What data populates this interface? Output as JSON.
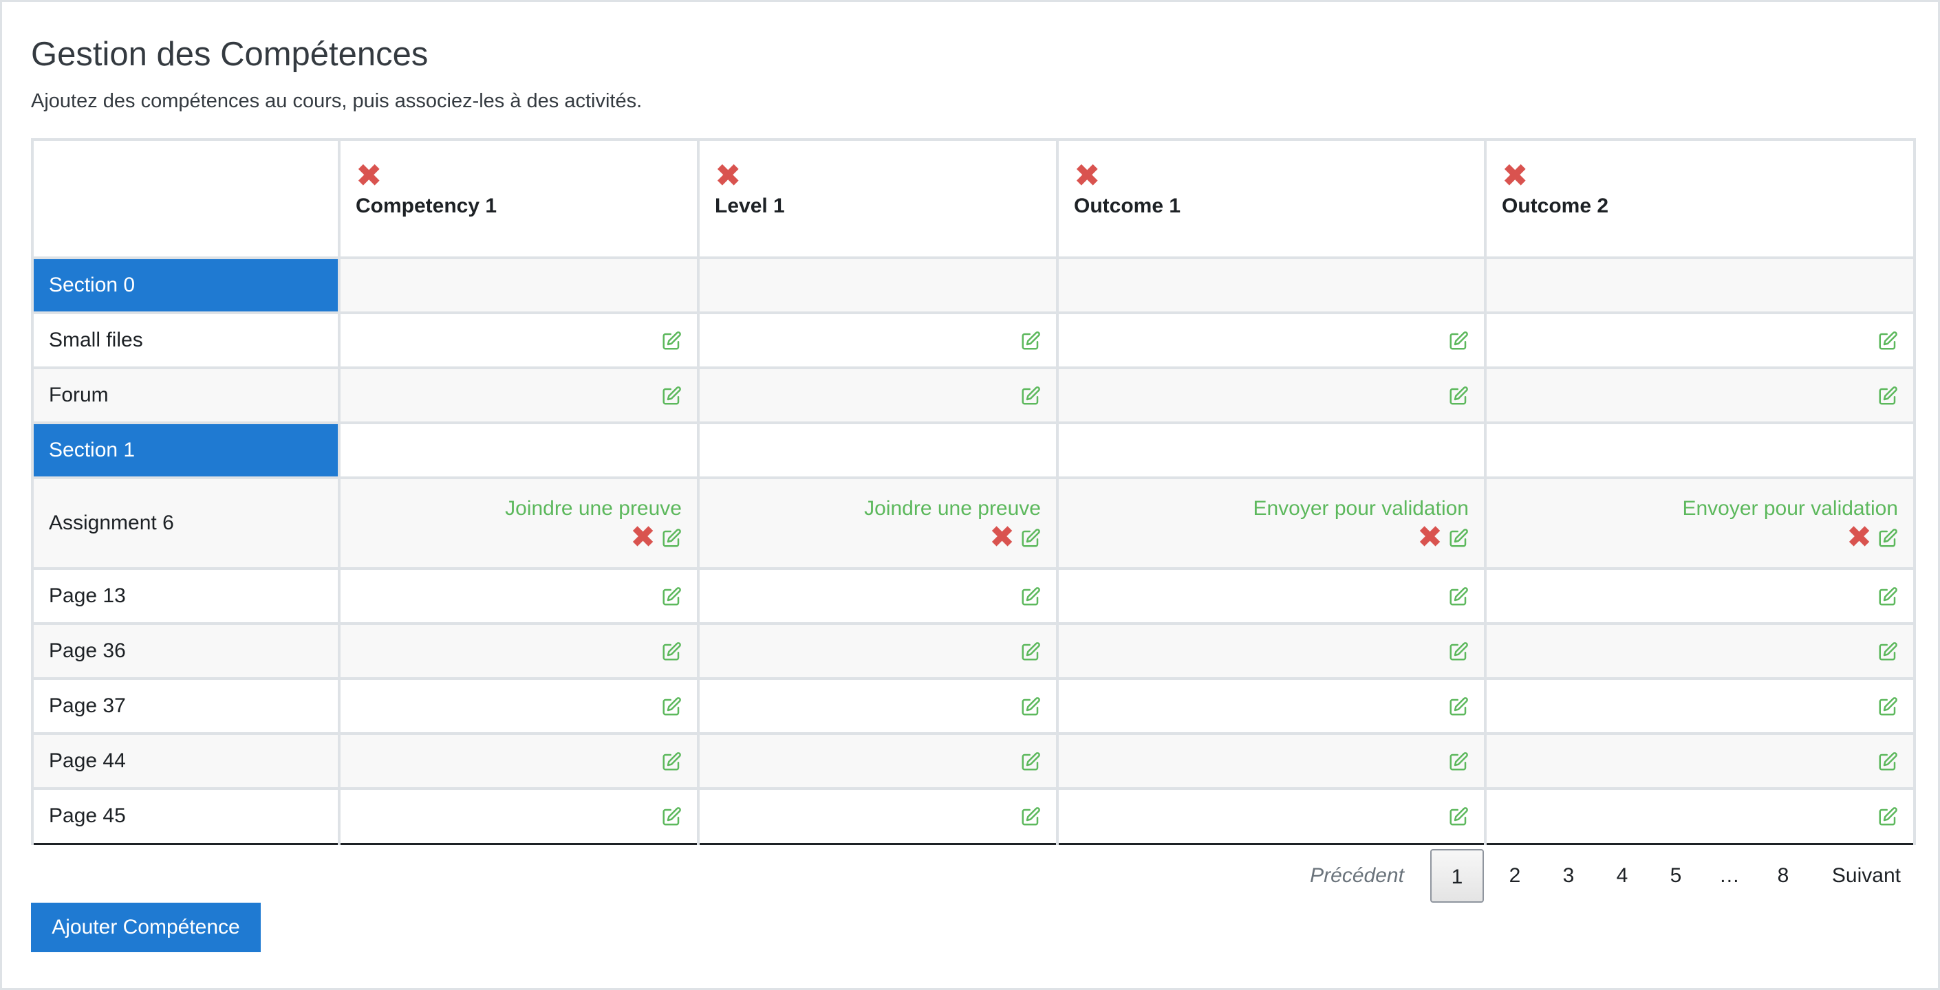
{
  "page": {
    "title": "Gestion des Compétences",
    "subtitle": "Ajoutez des compétences au cours, puis associez-les à des activités."
  },
  "columns": [
    {
      "name": "Competency 1"
    },
    {
      "name": "Level 1"
    },
    {
      "name": "Outcome 1"
    },
    {
      "name": "Outcome 2"
    }
  ],
  "rows": [
    {
      "type": "section",
      "label": "Section 0"
    },
    {
      "type": "item",
      "label": "Small files"
    },
    {
      "type": "item",
      "label": "Forum"
    },
    {
      "type": "section",
      "label": "Section 1"
    },
    {
      "type": "item",
      "label": "Assignment 6",
      "links": [
        "Joindre une preuve",
        "Joindre une preuve",
        "Envoyer pour validation",
        "Envoyer pour validation"
      ]
    },
    {
      "type": "item",
      "label": "Page 13"
    },
    {
      "type": "item",
      "label": "Page 36"
    },
    {
      "type": "item",
      "label": "Page 37"
    },
    {
      "type": "item",
      "label": "Page 44"
    },
    {
      "type": "item",
      "label": "Page 45"
    }
  ],
  "icons": {
    "delete": "close-icon",
    "edit": "edit-icon",
    "delete_color": "#d9534f",
    "edit_color": "#5cb85c"
  },
  "pagination": {
    "prev": "Précédent",
    "pages": [
      "1",
      "2",
      "3",
      "4",
      "5",
      "…",
      "8"
    ],
    "current": "1",
    "next": "Suivant"
  },
  "actions": {
    "add_label": "Ajouter Compétence",
    "accent_color": "#1f7ad2"
  }
}
